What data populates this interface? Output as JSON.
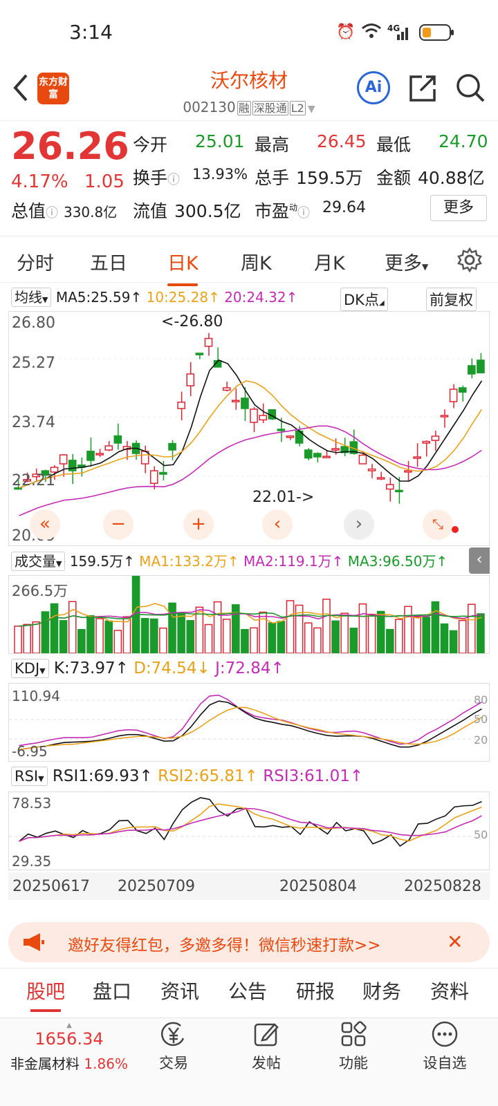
{
  "status_bar": {
    "time": "3:14",
    "net_label": "4G"
  },
  "header": {
    "stock_name": "沃尔核材",
    "stock_code": "002130",
    "tags": [
      "融",
      "深股通",
      "L2"
    ],
    "app_logo": "东方财富",
    "ai_label": "Ai"
  },
  "quote": {
    "price": "26.26",
    "change_pct": "4.17%",
    "change_abs": "1.05",
    "rows": [
      [
        {
          "label": "今开",
          "value": "25.01",
          "color": "green"
        },
        {
          "label": "最高",
          "value": "26.45",
          "color": "red"
        },
        {
          "label": "最低",
          "value": "24.70",
          "color": "green"
        }
      ],
      [
        {
          "label": "换手",
          "value": "13.93%",
          "color": "dark"
        },
        {
          "label": "总手",
          "value": "159.5万",
          "color": "dark"
        },
        {
          "label": "金额",
          "value": "40.88亿",
          "color": "dark"
        }
      ],
      [
        {
          "label": "总值",
          "value": "330.8亿",
          "color": "dark"
        },
        {
          "label": "流值",
          "value": "300.5亿",
          "color": "dark"
        },
        {
          "label": "市盈",
          "value": "29.64",
          "color": "dark"
        }
      ]
    ],
    "pe_sup": "动",
    "more_label": "更多"
  },
  "period_tabs": [
    "分时",
    "五日",
    "日K",
    "周K",
    "月K",
    "更多"
  ],
  "active_period": "日K",
  "main_chart": {
    "indicator_select": "均线",
    "ma5": "MA5:25.59",
    "ma10": "10:25.28",
    "ma20": "20:24.32",
    "dk_label": "DK点",
    "adjust_label": "前复权",
    "y_labels": [
      "26.80",
      "25.27",
      "23.74",
      "22.21",
      "20.69"
    ],
    "high_annot": "<-26.80",
    "low_annot": "22.01->"
  },
  "volume_chart": {
    "indicator_select": "成交量",
    "vol": "159.5万",
    "ma1": "MA1:133.2万",
    "ma2": "MA2:119.1万",
    "ma3": "MA3:96.50万",
    "y_label": "266.5万"
  },
  "kdj_chart": {
    "indicator_select": "KDJ",
    "k": "K:73.97",
    "d": "D:74.54",
    "j": "J:72.84",
    "y_top": "110.94",
    "y_bottom": "-6.95",
    "levels": [
      "80",
      "50",
      "20"
    ]
  },
  "rsi_chart": {
    "indicator_select": "RSI",
    "rsi1": "RSI1:69.93",
    "rsi2": "RSI2:65.81",
    "rsi3": "RSI3:61.01",
    "y_top": "78.53",
    "y_bottom": "29.35",
    "level": "50"
  },
  "dates": [
    "20250617",
    "20250709",
    "20250804",
    "20250828"
  ],
  "banner": {
    "text": "邀好友得红包，多邀多得！微信秒速打款>>"
  },
  "bottom_tabs": [
    "股吧",
    "盘口",
    "资讯",
    "公告",
    "研报",
    "财务",
    "资料"
  ],
  "active_bottom_tab": "股吧",
  "dock": {
    "index_value": "1656.34",
    "index_name": "非金属材料",
    "index_change": "1.86%",
    "items": [
      "交易",
      "发帖",
      "功能",
      "设自选"
    ]
  }
}
